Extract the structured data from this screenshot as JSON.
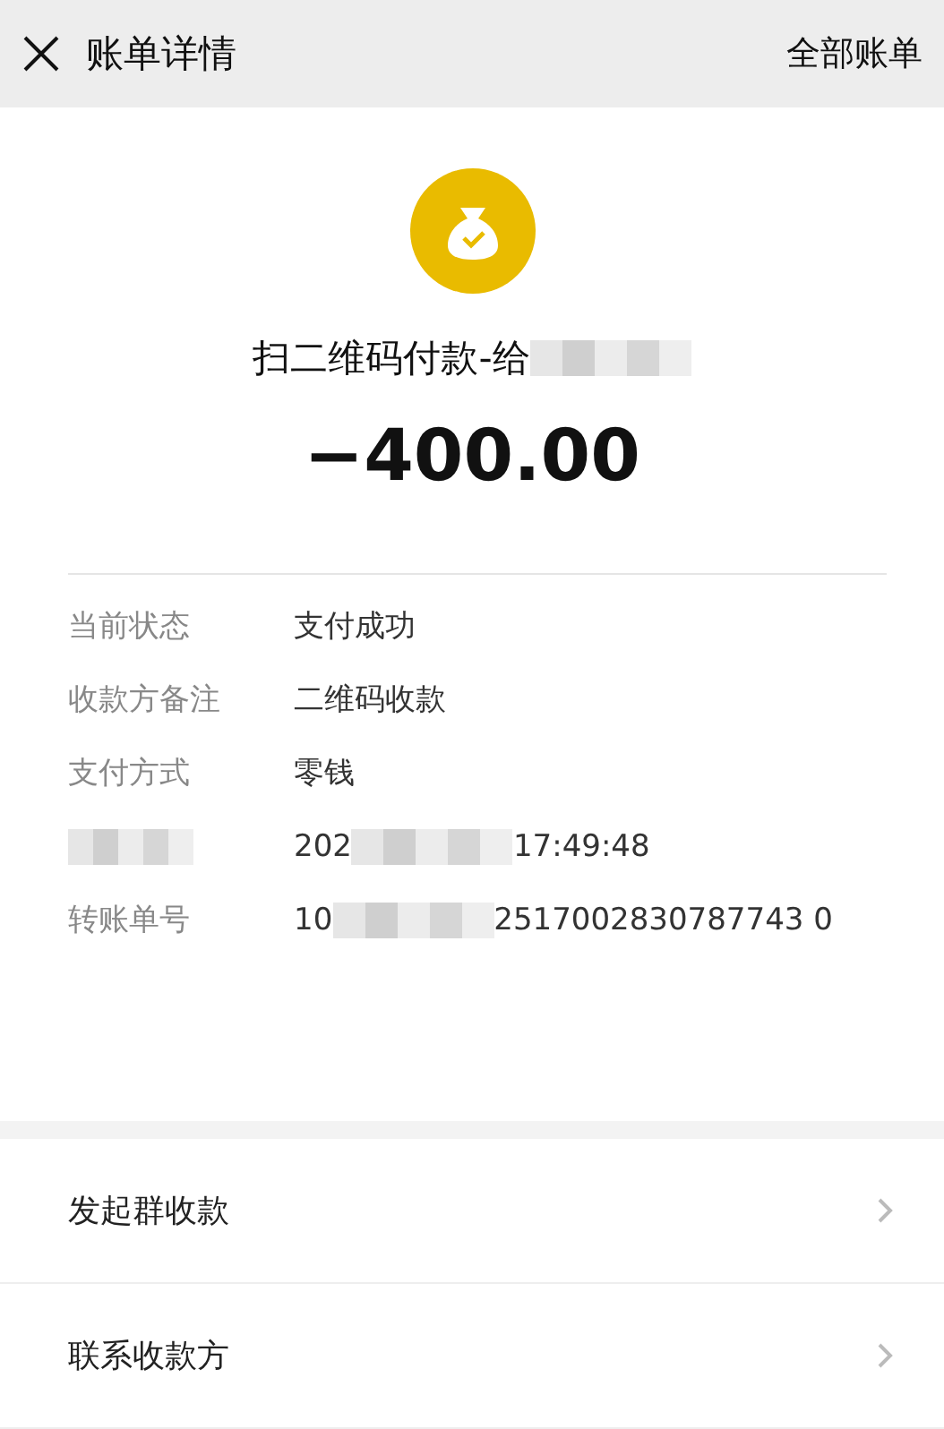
{
  "header": {
    "title": "账单详情",
    "action": "全部账单"
  },
  "summary": {
    "title_parts": [
      "扫二维码付款-给"
    ],
    "amount": "−400.00"
  },
  "details": [
    {
      "label": "当前状态",
      "parts": [
        "支付成功"
      ]
    },
    {
      "label": "收款方备注",
      "parts": [
        "二维码收款"
      ]
    },
    {
      "label": "支付方式",
      "parts": [
        "零钱"
      ]
    },
    {
      "parts": [
        "202",
        "17:49:48"
      ]
    },
    {
      "label": "转账单号",
      "parts": [
        "10",
        "2517002830787743 0"
      ]
    }
  ],
  "menu": [
    {
      "label": "发起群收款"
    },
    {
      "label": "联系收款方"
    }
  ]
}
